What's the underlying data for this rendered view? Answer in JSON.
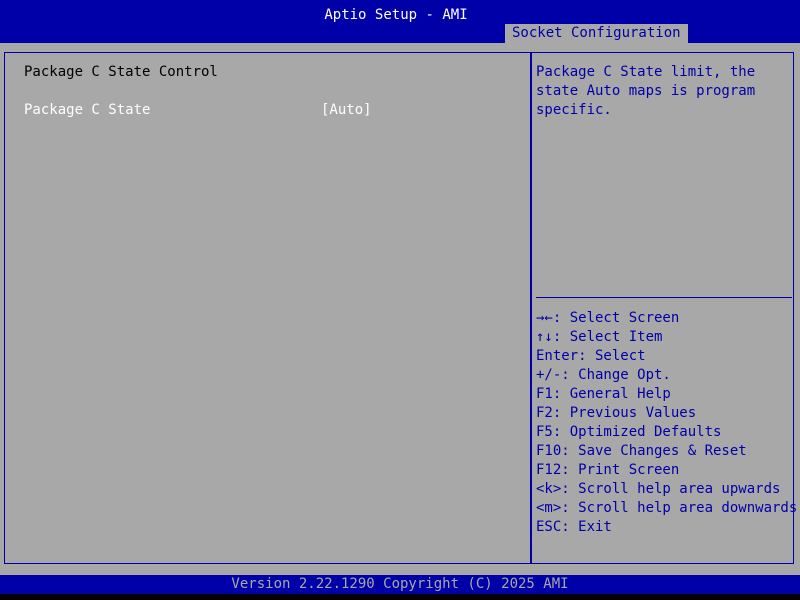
{
  "header": {
    "title": "Aptio Setup - AMI",
    "active_tab": "Socket Configuration"
  },
  "main": {
    "section_heading": "Package C State Control",
    "settings": [
      {
        "label": "Package C State",
        "value": "[Auto]"
      }
    ]
  },
  "help": {
    "text": "Package C State limit, the\nstate Auto maps is program\nspecific."
  },
  "keys": [
    "→←: Select Screen",
    "↑↓: Select Item",
    "Enter: Select",
    "+/-: Change Opt.",
    "F1: General Help",
    "F2: Previous Values",
    "F5: Optimized Defaults",
    "F10: Save Changes & Reset",
    "F12: Print Screen",
    "<k>: Scroll help area upwards",
    "<m>: Scroll help area downwards",
    "ESC: Exit"
  ],
  "footer": {
    "version": "Version 2.22.1290 Copyright (C) 2025 AMI"
  },
  "colors": {
    "header_blue": "#0000a8",
    "panel_gray": "#a8a8a8",
    "value_white": "#ffffff",
    "heading_black": "#000000"
  }
}
